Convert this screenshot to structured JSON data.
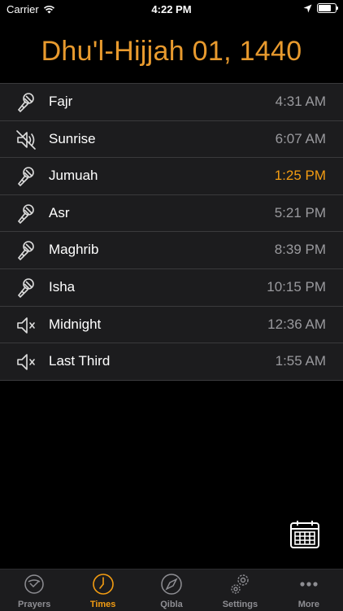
{
  "status_bar": {
    "carrier": "Carrier",
    "time": "4:22 PM",
    "battery_level": 0.85
  },
  "header": {
    "hijri_date": "Dhu'l-Hijjah 01, 1440"
  },
  "prayers": [
    {
      "name": "Fajr",
      "time": "4:31 AM",
      "icon": "microphone-icon",
      "active": false
    },
    {
      "name": "Sunrise",
      "time": "6:07 AM",
      "icon": "speaker-muted-icon",
      "active": false
    },
    {
      "name": "Jumuah",
      "time": "1:25 PM",
      "icon": "microphone-icon",
      "active": true
    },
    {
      "name": "Asr",
      "time": "5:21 PM",
      "icon": "microphone-icon",
      "active": false
    },
    {
      "name": "Maghrib",
      "time": "8:39 PM",
      "icon": "microphone-icon",
      "active": false
    },
    {
      "name": "Isha",
      "time": "10:15 PM",
      "icon": "microphone-icon",
      "active": false
    },
    {
      "name": "Midnight",
      "time": "12:36 AM",
      "icon": "speaker-off-icon",
      "active": false
    },
    {
      "name": "Last Third",
      "time": "1:55 AM",
      "icon": "speaker-off-icon",
      "active": false
    }
  ],
  "tabs": [
    {
      "label": "Prayers",
      "icon": "prayers-icon",
      "selected": false
    },
    {
      "label": "Times",
      "icon": "clock-icon",
      "selected": true
    },
    {
      "label": "Qibla",
      "icon": "compass-icon",
      "selected": false
    },
    {
      "label": "Settings",
      "icon": "gear-icon",
      "selected": false
    },
    {
      "label": "More",
      "icon": "more-icon",
      "selected": false
    }
  ],
  "colors": {
    "accent": "#F39C12",
    "header_text": "#E89A2E",
    "row_background": "#1c1c1e",
    "time_text": "#9a9a9e"
  }
}
